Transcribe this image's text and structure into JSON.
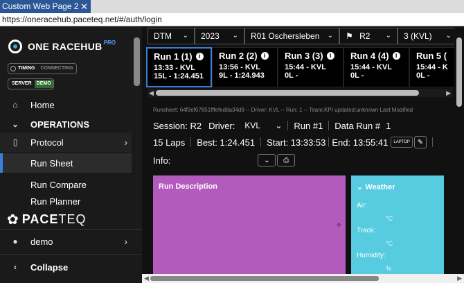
{
  "window": {
    "tab_title": "Custom Web Page 2",
    "close_glyph": "✕",
    "url": "https://oneracehub.paceteq.net/#/auth/login"
  },
  "sidebar": {
    "brand": "ONE RACEHUB",
    "brand_suffix": "PRO",
    "status_timing": "TIMING",
    "status_connecting": "CONNECTING",
    "status_server": "SERVER",
    "status_demo": "DEMO",
    "items": [
      {
        "label": "Home",
        "icon": "home-icon"
      },
      {
        "label": "OPERATIONS",
        "icon": "chevron-down-icon"
      },
      {
        "label": "Protocol",
        "icon": "clipboard-icon"
      },
      {
        "label": "Run Sheet"
      },
      {
        "label": "Run Compare"
      },
      {
        "label": "Run Planner"
      }
    ],
    "company": "PACETEQ",
    "company_bold": "PACE",
    "company_thin": "TEQ",
    "user": "demo",
    "collapse": "Collapse"
  },
  "filters": {
    "series": "DTM",
    "year": "2023",
    "event": "R01 Oschersleben",
    "session": "R2",
    "driver": "3 (KVL)"
  },
  "runs": [
    {
      "title": "Run 1 (1)",
      "time": "13:33 - KVL",
      "laps": "15L - 1:24.451"
    },
    {
      "title": "Run 2 (2)",
      "time": "13:56 - KVL",
      "laps": "9L - 1:24.943"
    },
    {
      "title": "Run 3 (3)",
      "time": "15:44 - KVL",
      "laps": "0L -"
    },
    {
      "title": "Run 4 (4)",
      "time": "15:44 - KVL",
      "laps": "0L -"
    },
    {
      "title": "Run 5 (",
      "time": "15:44 - K",
      "laps": "0L -"
    }
  ],
  "runsheet": {
    "meta": "Runsheet: 64f9ef07851fffefed8a34d9 -- Driver: KVL -- Run: 1 -- Team:KPI updated:unknown   Last Modified",
    "session_label": "Session: R2",
    "driver_label": "Driver:",
    "driver_value": "KVL",
    "run_label": "Run #1",
    "data_run_label": "Data Run #",
    "data_run_value": "1",
    "laps": "15 Laps",
    "best": "Best: 1:24.451",
    "start": "Start: 13:33:53",
    "end": "End: 13:55:41",
    "laptop_btn": "LAPTOP",
    "info_label": "Info:",
    "description_title": "Run Description",
    "weather_title": "Weather",
    "air": "Air:",
    "track": "Track:",
    "humidity": "Humidity:",
    "unit_c": "°C",
    "unit_pct": "%"
  }
}
